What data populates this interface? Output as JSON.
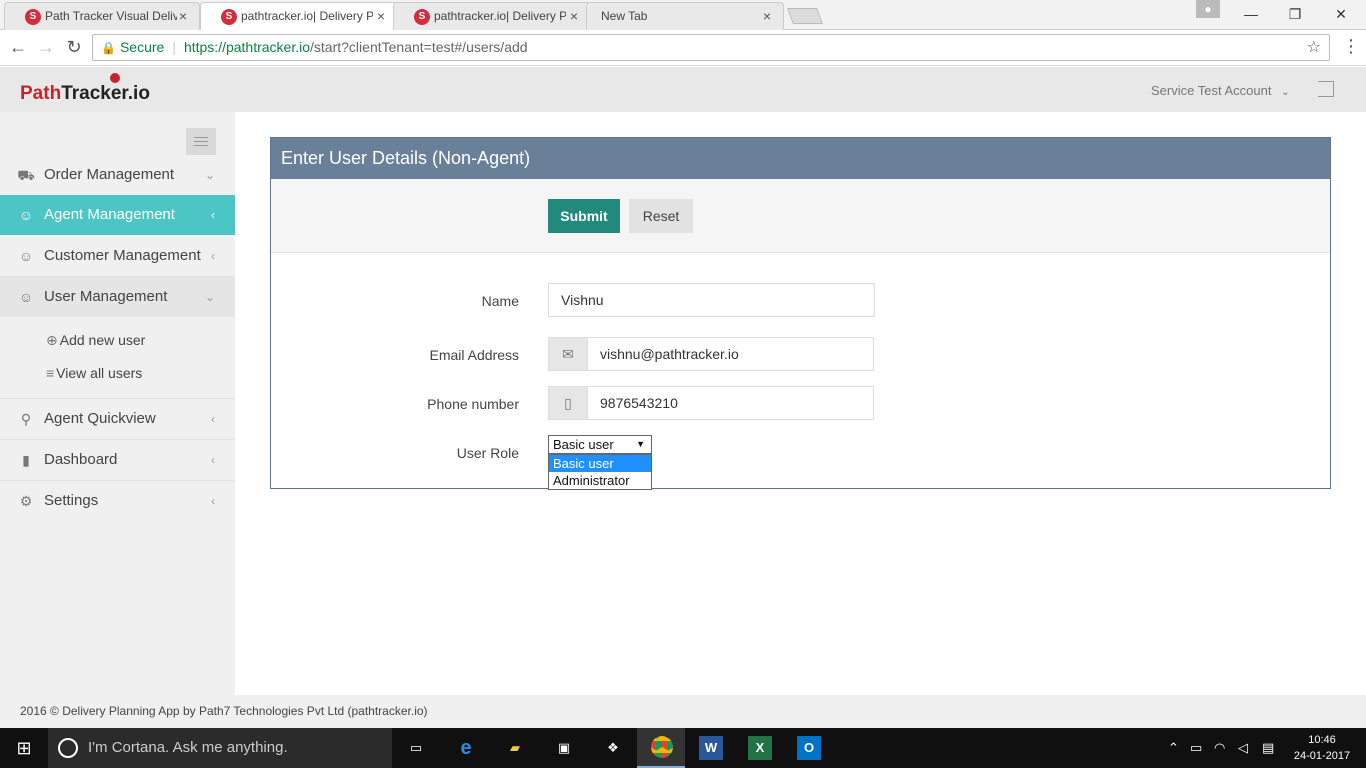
{
  "browser": {
    "tabs": [
      {
        "label": "Path Tracker Visual Delive",
        "state": "inactive"
      },
      {
        "label": "pathtracker.io| Delivery P",
        "state": "active"
      },
      {
        "label": "pathtracker.io| Delivery P",
        "state": "inactive"
      },
      {
        "label": "New Tab",
        "state": "inactive"
      }
    ],
    "secure_label": "Secure",
    "url_host": "https://pathtracker.io",
    "url_path": "/start?clientTenant=test#/users/add"
  },
  "header": {
    "logo_part1": "Path",
    "logo_part2": "Tracker",
    "logo_part3": ".io",
    "account": "Service Test Account"
  },
  "sidebar": {
    "items": [
      {
        "label": "Order Management",
        "icon": "truck-icon",
        "chevron": "down"
      },
      {
        "label": "Agent Management",
        "icon": "agent-icon",
        "chevron": "left",
        "active": true
      },
      {
        "label": "Customer Management",
        "icon": "customer-icon",
        "chevron": "left"
      },
      {
        "label": "User Management",
        "icon": "user-icon",
        "chevron": "down",
        "open": true
      },
      {
        "label": "Agent Quickview",
        "icon": "bike-icon",
        "chevron": "left"
      },
      {
        "label": "Dashboard",
        "icon": "bar-chart-icon",
        "chevron": "left"
      },
      {
        "label": "Settings",
        "icon": "gear-icon",
        "chevron": "left"
      }
    ],
    "sub_items": [
      {
        "label": "Add new user"
      },
      {
        "label": "View all users"
      }
    ]
  },
  "form": {
    "title": "Enter User Details (Non-Agent)",
    "submit_label": "Submit",
    "reset_label": "Reset",
    "name_label": "Name",
    "name_value": "Vishnu",
    "email_label": "Email Address",
    "email_value": "vishnu@pathtracker.io",
    "phone_label": "Phone number",
    "phone_value": "9876543210",
    "role_label": "User Role",
    "role_value": "Basic user",
    "role_options": [
      "Basic user",
      "Administrator"
    ]
  },
  "footer": {
    "text": "2016 © Delivery Planning App by Path7 Technologies Pvt Ltd (pathtracker.io)"
  },
  "taskbar": {
    "cortana_placeholder": "I'm Cortana. Ask me anything.",
    "time": "10:46",
    "date": "24-01-2017"
  },
  "colors": {
    "accent": "#4cc6c4",
    "panel_header": "#6a7f98",
    "submit": "#228a7c"
  }
}
